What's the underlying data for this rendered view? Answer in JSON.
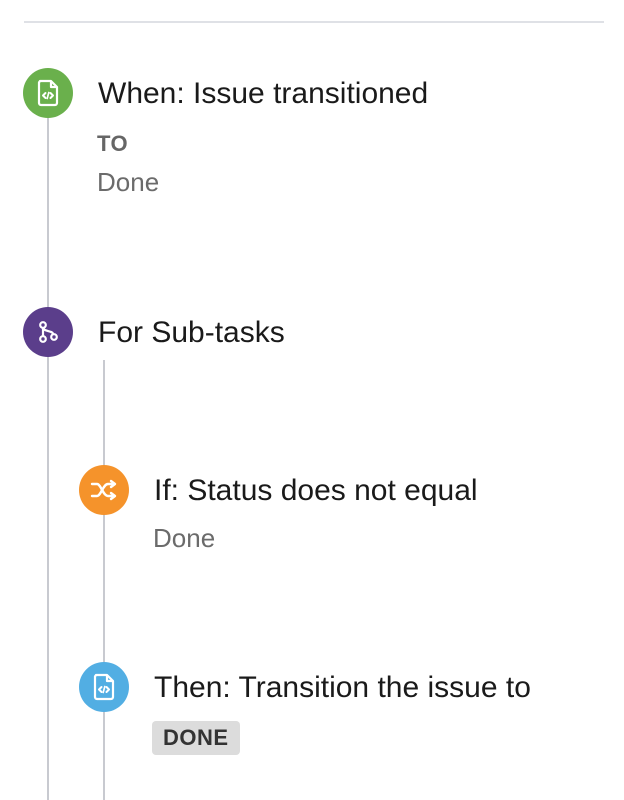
{
  "rule": {
    "trigger": {
      "title": "When: Issue transitioned",
      "field_label": "TO",
      "field_value": "Done",
      "icon": "file-code-icon",
      "color": "#6ab04c"
    },
    "branch": {
      "title": "For Sub-tasks",
      "icon": "branch-icon",
      "color": "#5b3e8b"
    },
    "condition": {
      "title": "If: Status does not equal",
      "value": "Done",
      "icon": "shuffle-icon",
      "color": "#f5932b"
    },
    "action": {
      "title": "Then: Transition the issue to",
      "status": "DONE",
      "icon": "file-code-icon",
      "color": "#52aee3"
    }
  }
}
